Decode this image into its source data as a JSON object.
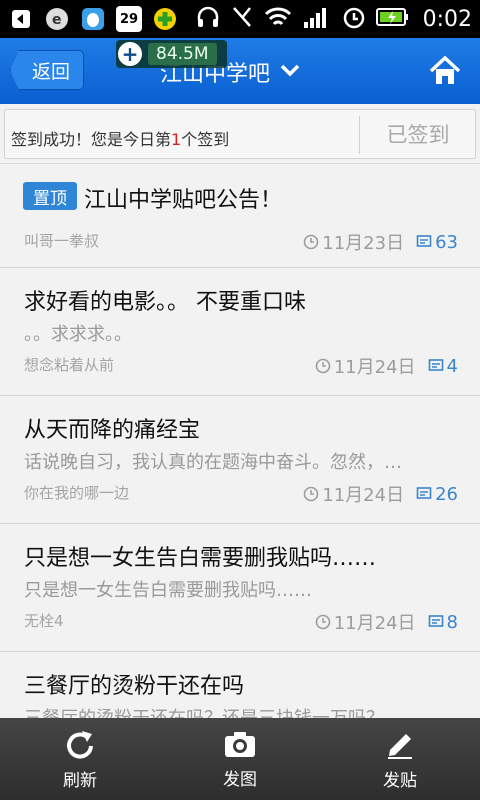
{
  "status_bar": {
    "time": "0:02",
    "notification_badge": "29"
  },
  "header": {
    "back_label": "返回",
    "title": "江山中学吧",
    "floating_indicator": "84.5M"
  },
  "sign_in": {
    "message_prefix": "签到成功！您是今日第",
    "rank": "1",
    "message_suffix": "个签到",
    "button_label": "已签到"
  },
  "posts": [
    {
      "pinned_label": "置顶",
      "title": "江山中学贴吧公告！",
      "subtitle": "",
      "author": "叫哥一拳叔",
      "date": "11月23日",
      "replies": "63"
    },
    {
      "title": "求好看的电影。。 不要重口味",
      "subtitle": "。。求求求。。",
      "author": "想念粘着从前",
      "date": "11月24日",
      "replies": "4"
    },
    {
      "title": "从天而降的痛经宝",
      "subtitle": "话说晚自习，我认真的在题海中奋斗。忽然，…",
      "author": "你在我的哪一边",
      "date": "11月24日",
      "replies": "26"
    },
    {
      "title": "只是想一女生告白需要删我贴吗……",
      "subtitle": "只是想一女生告白需要删我贴吗……",
      "author": "无栓4",
      "date": "11月24日",
      "replies": "8"
    },
    {
      "title": "三餐厅的烫粉干还在吗",
      "subtitle": "三餐厅的烫粉干还在吗？还是三块钱一万吗？…",
      "author": "",
      "date": "",
      "replies": ""
    }
  ],
  "toolbar": {
    "refresh_label": "刷新",
    "photo_label": "发图",
    "post_label": "发贴"
  },
  "colors": {
    "header_blue": "#0a5fd0",
    "accent_blue": "#2f86d6",
    "rank_red": "#e02020"
  }
}
